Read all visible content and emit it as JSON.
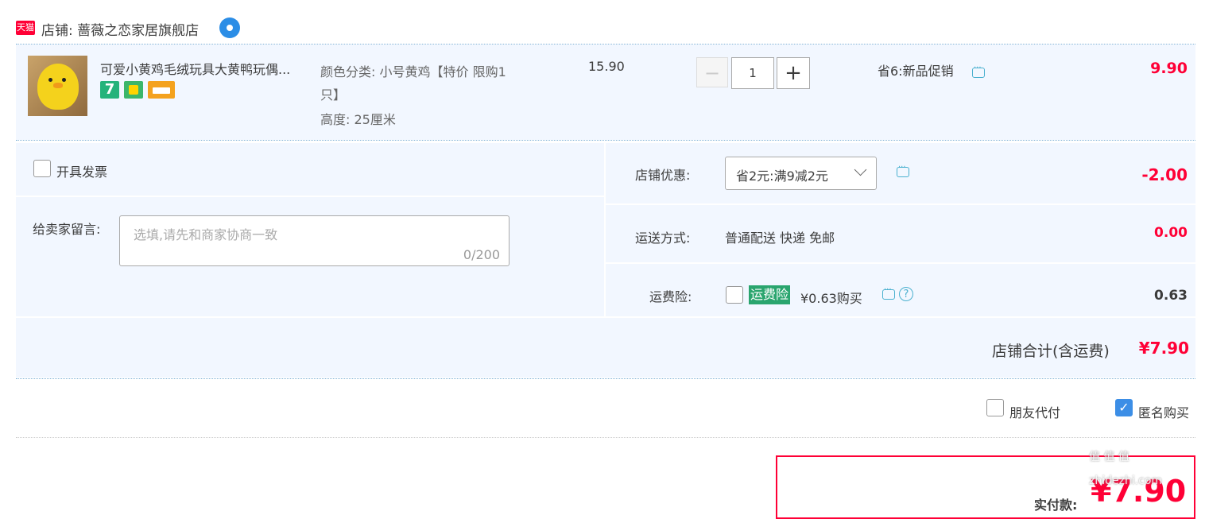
{
  "store": {
    "tmall_logo_text": "天猫",
    "label": "店铺: 蔷薇之恋家居旗舰店",
    "wangwang_icon": "wangwang-chat-icon"
  },
  "item": {
    "title": "可爱小黄鸡毛绒玩具大黄鸭玩偶...",
    "badges": [
      "7",
      "tmall-bag-icon",
      "card-icon"
    ],
    "attr_color_line1": "颜色分类: 小号黄鸡【特价 限购1",
    "attr_color_line2": "只】",
    "attr_height": "高度: 25厘米",
    "unit_price": "15.90",
    "quantity": "1",
    "qty_minus": "−",
    "qty_plus": "+",
    "promotion": "省6:新品促销",
    "subtotal": "9.90"
  },
  "invoice": {
    "label": "开具发票"
  },
  "message": {
    "label": "给卖家留言:",
    "placeholder": "选填,请先和商家协商一致",
    "counter": "0/200"
  },
  "store_discount": {
    "label": "店铺优惠:",
    "selected": "省2元:满9减2元",
    "amount": "-2.00"
  },
  "shipping": {
    "label": "运送方式:",
    "value": "普通配送 快递 免邮",
    "amount": "0.00"
  },
  "shipping_insurance": {
    "label": "运费险:",
    "tag": "运费险",
    "price": "¥0.63购买",
    "amount": "0.63",
    "help": "?"
  },
  "store_total": {
    "label": "店铺合计(含运费)",
    "amount": "¥7.90"
  },
  "options": {
    "friend_pay": "朋友代付",
    "anonymous": "匿名购买",
    "anonymous_check": "✓"
  },
  "payment": {
    "label": "实付款:",
    "amount": "¥7.90"
  },
  "watermark": "值 值 值 zhidezhi.com",
  "colors": {
    "accent_red": "#ff0036",
    "panel_bg": "#f2f7ff",
    "link_blue": "#4ab0cf",
    "insurance_green": "#2aa56e"
  }
}
